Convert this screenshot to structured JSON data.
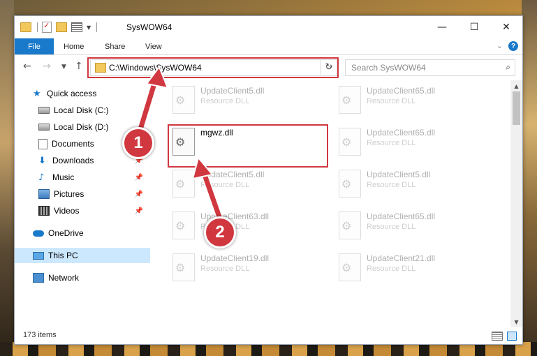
{
  "window": {
    "title": "SysWOW64",
    "controls": {
      "minimize": "—",
      "maximize": "☐",
      "close": "✕"
    }
  },
  "ribbon": {
    "tabs": [
      "File",
      "Home",
      "Share",
      "View"
    ],
    "help": "?"
  },
  "address_bar": {
    "path": "C:\\Windows\\SysWOW64"
  },
  "search": {
    "placeholder": "Search SysWOW64"
  },
  "sidebar": {
    "items": [
      {
        "label": "Quick access",
        "icon": "star-icon"
      },
      {
        "label": "Local Disk (C:)",
        "icon": "drive-icon"
      },
      {
        "label": "Local Disk (D:)",
        "icon": "drive-icon"
      },
      {
        "label": "Documents",
        "icon": "document-icon"
      },
      {
        "label": "Downloads",
        "icon": "download-icon"
      },
      {
        "label": "Music",
        "icon": "music-icon"
      },
      {
        "label": "Pictures",
        "icon": "pictures-icon"
      },
      {
        "label": "Videos",
        "icon": "videos-icon"
      },
      {
        "label": "OneDrive",
        "icon": "cloud-icon"
      },
      {
        "label": "This PC",
        "icon": "computer-icon",
        "selected": true
      },
      {
        "label": "Network",
        "icon": "network-icon"
      }
    ]
  },
  "files": [
    {
      "name": "UpdateClient5.dll",
      "type": "Resource DLL"
    },
    {
      "name": "UpdateClient65.dll",
      "type": "Resource DLL"
    },
    {
      "name": "mgwz.dll",
      "type": ""
    },
    {
      "name": "UpdateClient65.dll",
      "type": "Resource DLL"
    },
    {
      "name": "UpdateClient5.dll",
      "type": "Resource DLL"
    },
    {
      "name": "UpdateClient5.dll",
      "type": "Resource DLL"
    },
    {
      "name": "UpdateClient63.dll",
      "type": "Resource DLL"
    },
    {
      "name": "UpdateClient65.dll",
      "type": "Resource DLL"
    },
    {
      "name": "UpdateClient19.dll",
      "type": "Resource DLL"
    },
    {
      "name": "UpdateClient21.dll",
      "type": "Resource DLL"
    }
  ],
  "status": {
    "item_count": "173 items"
  },
  "callouts": [
    "1",
    "2"
  ],
  "colors": {
    "accent": "#1979ca",
    "highlight": "#d0373f",
    "selected_bg": "#cce8ff"
  }
}
